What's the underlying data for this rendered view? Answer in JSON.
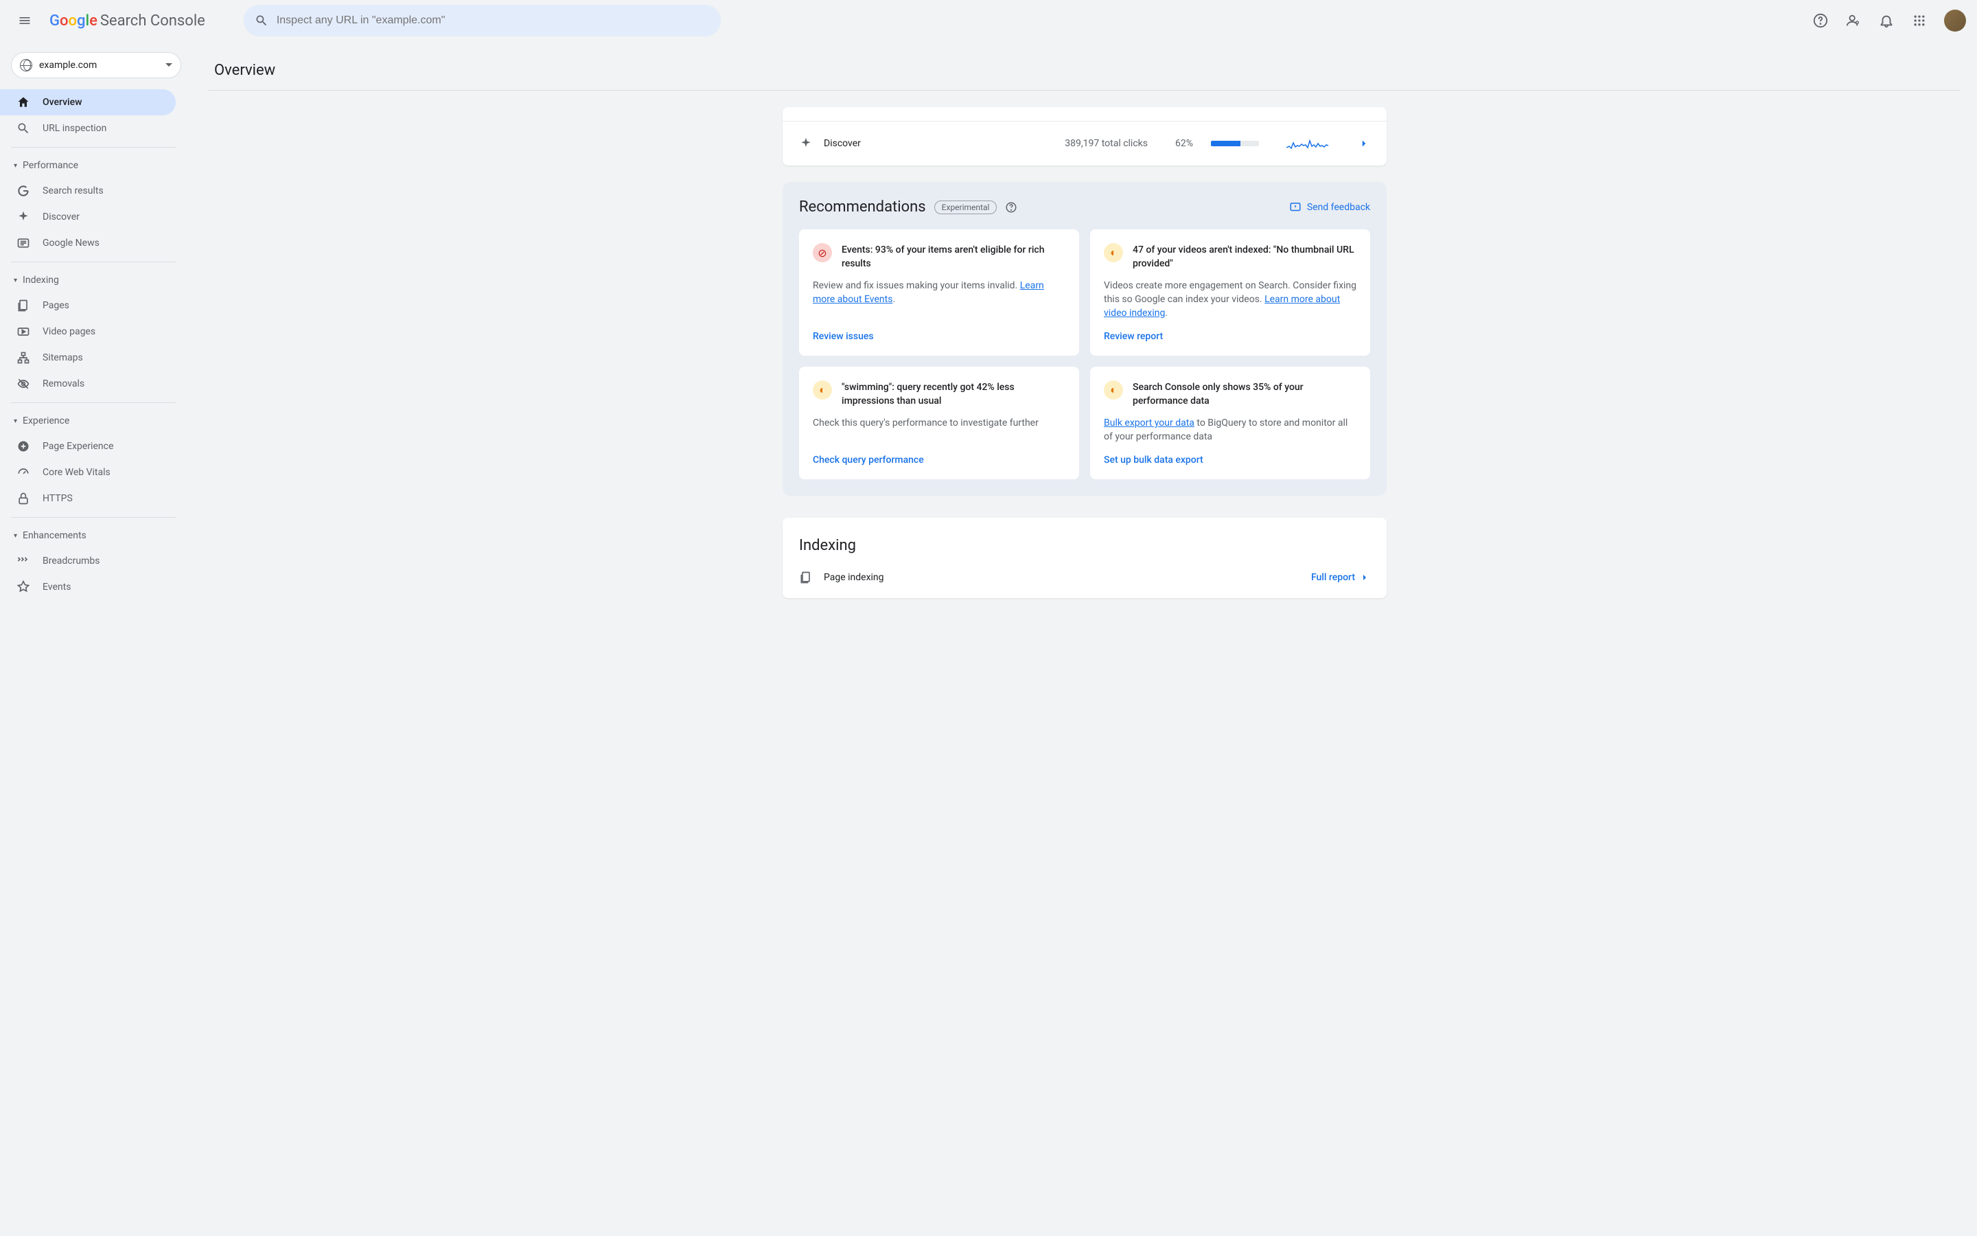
{
  "brand": {
    "g": "G",
    "o1": "o",
    "o2": "o",
    "g2": "g",
    "l": "l",
    "e": "e",
    "product": "Search Console"
  },
  "search": {
    "placeholder": "Inspect any URL in \"example.com\""
  },
  "property": {
    "domain": "example.com"
  },
  "nav": {
    "overview": "Overview",
    "url_inspection": "URL inspection",
    "sections": {
      "performance": "Performance",
      "indexing": "Indexing",
      "experience": "Experience",
      "enhancements": "Enhancements"
    },
    "items": {
      "search_results": "Search results",
      "discover": "Discover",
      "google_news": "Google News",
      "pages": "Pages",
      "video_pages": "Video pages",
      "sitemaps": "Sitemaps",
      "removals": "Removals",
      "page_experience": "Page Experience",
      "core_web_vitals": "Core Web Vitals",
      "https": "HTTPS",
      "breadcrumbs": "Breadcrumbs",
      "events": "Events"
    }
  },
  "page": {
    "title": "Overview"
  },
  "discover_row": {
    "label": "Discover",
    "clicks": "389,197 total clicks",
    "pct": "62%",
    "pct_val": 62
  },
  "recommendations": {
    "title": "Recommendations",
    "badge": "Experimental",
    "feedback": "Send feedback",
    "cards": [
      {
        "type": "err",
        "title": "Events: 93% of your items aren't eligible for rich results",
        "body_pre": "Review and fix issues making your items invalid. ",
        "link": "Learn more about Events",
        "body_post": ".",
        "action": "Review issues"
      },
      {
        "type": "tip",
        "title": "47 of your videos aren't indexed: \"No thumbnail URL provided\"",
        "body_pre": "Videos create more engagement on Search. Consider fixing this so Google can index your videos. ",
        "link": "Learn more about video indexing",
        "body_post": ".",
        "action": "Review report"
      },
      {
        "type": "tip",
        "title": "\"swimming\": query recently got 42% less impressions than usual",
        "body_pre": "Check this query's performance to investigate further",
        "link": "",
        "body_post": "",
        "action": "Check query performance"
      },
      {
        "type": "tip",
        "title": "Search Console only shows 35% of your performance data",
        "body_link_first": "Bulk export your data",
        "body_rest": " to BigQuery to store and monitor all of your performance data",
        "action": "Set up bulk data export"
      }
    ]
  },
  "indexing": {
    "title": "Indexing",
    "row_label": "Page indexing",
    "full_report": "Full report"
  }
}
